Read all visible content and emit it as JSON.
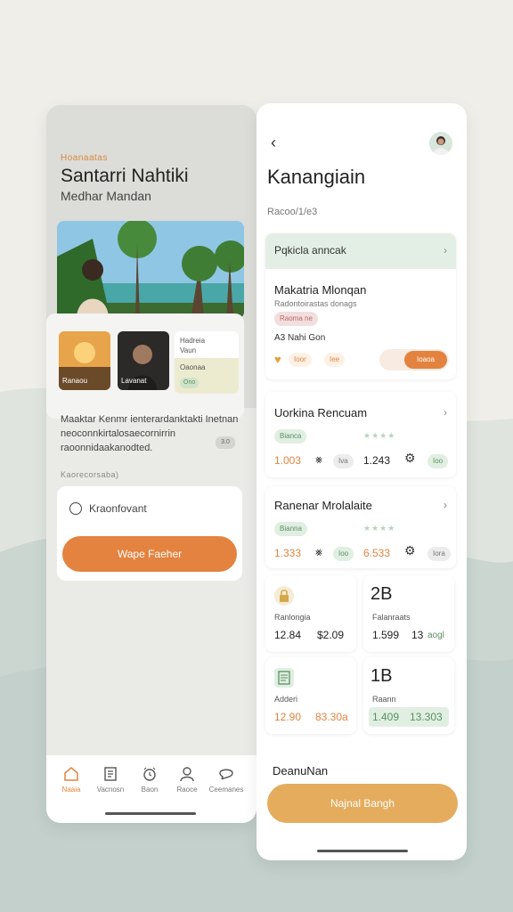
{
  "left_screen": {
    "kicker": "Hoanaatas",
    "title": "Santarri Nahtiki",
    "subtitle": "Medhar Mandan",
    "thumbs": [
      {
        "label": "Ranaou"
      },
      {
        "label": "Lavanat"
      }
    ],
    "mini_card": {
      "line1": "Hadreia",
      "line2": "Vaun",
      "line3": "Oaonaa",
      "badge": "Ono"
    },
    "description": "Maaktar Kenmr ienterardanktakti Inetnan neoconnkirtalosaecornirrin raoonnidaakanodted.",
    "desc_badge": "3.0",
    "section_label": "Kaorecorsaba)",
    "option_label": "Kraonfovant",
    "primary_button": "Wape Faeher",
    "nav": [
      {
        "label": "Naaia",
        "icon": "home-icon",
        "active": true
      },
      {
        "label": "Vacnosn",
        "icon": "document-icon",
        "active": false
      },
      {
        "label": "Baon",
        "icon": "alarm-clock-icon",
        "active": false
      },
      {
        "label": "Raoce",
        "icon": "user-icon",
        "active": false
      },
      {
        "label": "Ceemanes",
        "icon": "chat-bubble-icon",
        "active": false
      }
    ]
  },
  "right_screen": {
    "back_icon": "chevron-left-icon",
    "title": "Kanangiain",
    "subtitle": "Racoo/1/e3",
    "card1": {
      "header": "Pqkicla anncak",
      "title": "Makatria Mlonqan",
      "subtitle": "Radontoirastas donags",
      "pill": "Raoma ne",
      "label": "A3 Nahi Gon",
      "action1": "Ioor",
      "action2": "Iee",
      "action3": "Ioaoa"
    },
    "card2": {
      "title": "Uorkina Rencuam",
      "pill": "Bianca",
      "stars": "★★★★",
      "value1": "1.003",
      "value2": "1.243",
      "chip1": "Iva",
      "chip2": "Ioo"
    },
    "card3": {
      "title": "Ranenar Mrolalaite",
      "pill": "Bianna",
      "stars": "★★★★",
      "value1": "1.333",
      "value2": "6.533",
      "chip1": "Ioo",
      "chip2": "Iora"
    },
    "tiles": [
      {
        "big": "",
        "label": "Ranlongia",
        "v1": "12.84",
        "v2": "$2.09",
        "icon": "lock-icon"
      },
      {
        "big": "2B",
        "label": "Falanraats",
        "v1": "1.599",
        "v2": "13",
        "v3": "aogl"
      },
      {
        "big": "",
        "label": "Adderi",
        "v1": "12.90",
        "v2": "83.30a",
        "icon": "list-icon"
      },
      {
        "big": "1B",
        "label": "Raann",
        "v1": "1.409",
        "v2": "13.303"
      }
    ],
    "footer_title": "DeanuNan",
    "cta_button": "Najnal Bangh"
  },
  "colors": {
    "accent_orange": "#e3833f",
    "accent_gold": "#e5ac5d",
    "mint": "#e3efe5",
    "green_text": "#5b8f64"
  }
}
